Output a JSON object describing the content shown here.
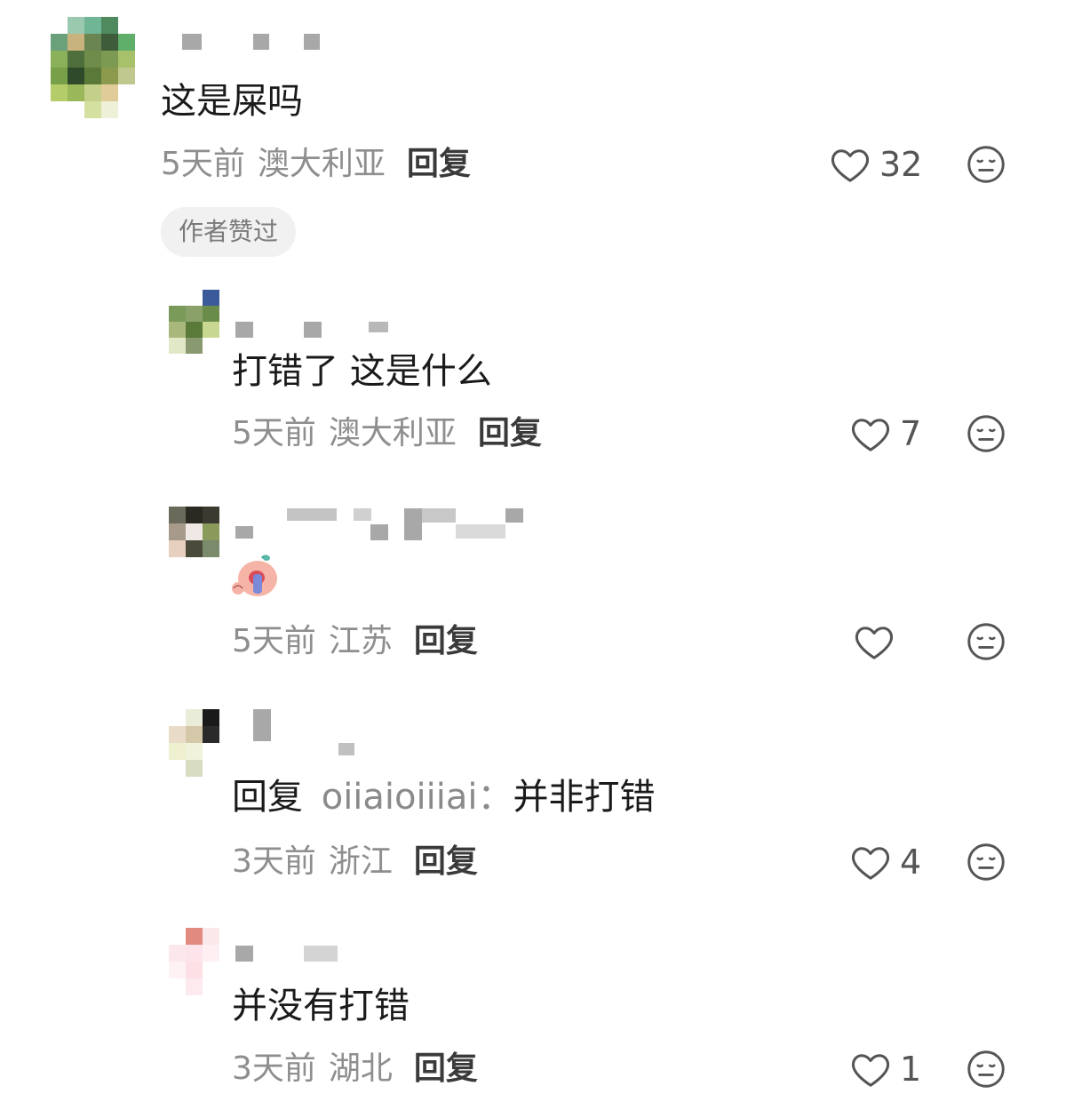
{
  "comments": [
    {
      "text": "这是屎吗",
      "time": "5天前",
      "location": "澳大利亚",
      "reply_label": "回复",
      "likes": "32",
      "badge": "作者赞过"
    },
    {
      "text": "打错了 这是什么",
      "time": "5天前",
      "location": "澳大利亚",
      "reply_label": "回复",
      "likes": "7"
    },
    {
      "time": "5天前",
      "location": "江苏",
      "reply_label": "回复",
      "likes": ""
    },
    {
      "reply_prefix": "回复",
      "reply_target": "oiiaioiiiai：",
      "text": "并非打错",
      "time": "3天前",
      "location": "浙江",
      "reply_label": "回复",
      "likes": "4"
    },
    {
      "text": "并没有打错",
      "time": "3天前",
      "location": "湖北",
      "reply_label": "回复",
      "likes": "1"
    }
  ],
  "icons": {
    "like": "heart-outline-icon",
    "dislike": "neutral-face-icon",
    "sticker": "crying-baby-sticker"
  },
  "colors": {
    "text": "#1a1a1a",
    "meta": "#8e8e8e",
    "badge_bg": "#f1f1f1"
  }
}
